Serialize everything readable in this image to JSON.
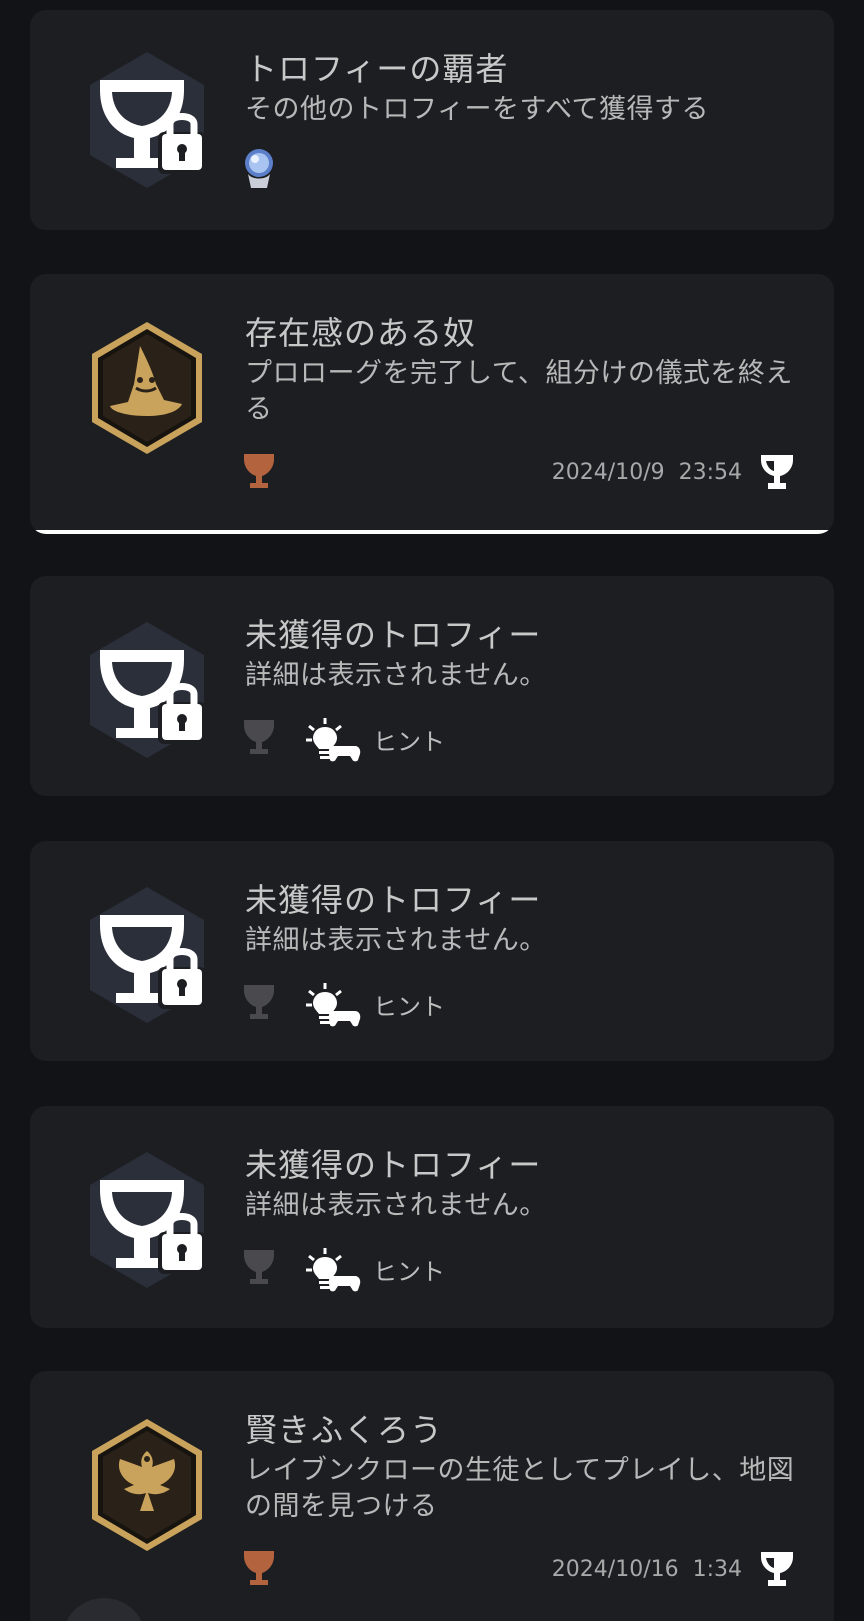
{
  "colors": {
    "background": "#121316",
    "card": "#1d1e22",
    "text_primary": "#c8c8c8",
    "text_secondary": "#b8b8b8",
    "bronze": "#b3643f",
    "gold_frame": "#c9a35b",
    "locked_hex": "#2b2f3a"
  },
  "trophies": [
    {
      "title": "トロフィーの覇者",
      "description": "その他のトロフィーをすべて獲得する",
      "grade": "platinum",
      "icon": "locked-trophy-icon",
      "earned": false
    },
    {
      "title": "存在感のある奴",
      "description": "プロローグを完了して、組分けの儀式を終える",
      "grade": "bronze",
      "icon": "sorting-hat-icon",
      "earned": true,
      "earned_date": "2024/10/9  23:54"
    },
    {
      "title": "未獲得のトロフィー",
      "description": "詳細は表示されません。",
      "grade": "hidden",
      "icon": "locked-trophy-icon",
      "hint_label": "ヒント",
      "earned": false
    },
    {
      "title": "未獲得のトロフィー",
      "description": "詳細は表示されません。",
      "grade": "hidden",
      "icon": "locked-trophy-icon",
      "hint_label": "ヒント",
      "earned": false
    },
    {
      "title": "未獲得のトロフィー",
      "description": "詳細は表示されません。",
      "grade": "hidden",
      "icon": "locked-trophy-icon",
      "hint_label": "ヒント",
      "earned": false
    },
    {
      "title": "賢きふくろう",
      "description": "レイブンクローの生徒としてプレイし、地図の間を見つける",
      "grade": "bronze",
      "icon": "ravenclaw-eagle-icon",
      "earned": true,
      "earned_date": "2024/10/16  1:34"
    }
  ]
}
